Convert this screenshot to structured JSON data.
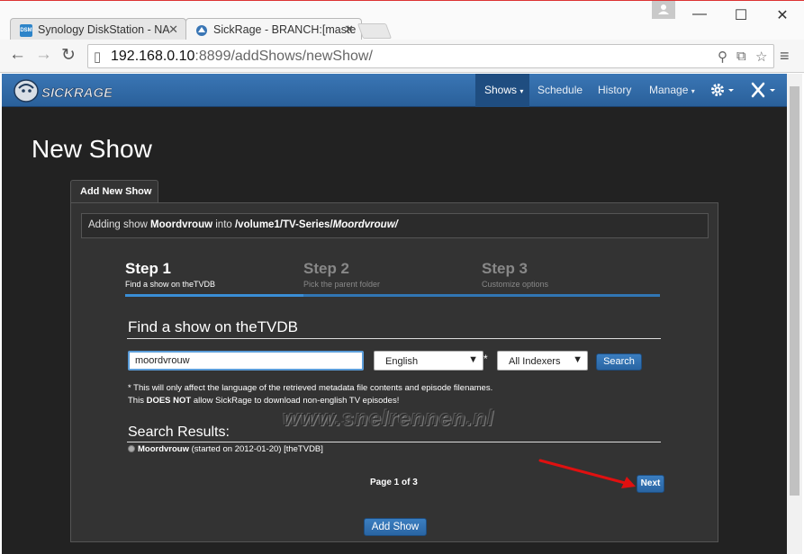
{
  "browser": {
    "tabs": [
      {
        "title": "Synology DiskStation - NA",
        "favicon_label": "DSM",
        "active": false
      },
      {
        "title": "SickRage - BRANCH:[maste",
        "active": true
      }
    ],
    "url": {
      "host": "192.168.0.10",
      "rest": ":8899/addShows/newShow/"
    }
  },
  "navbar": {
    "logo": "SICKRAGE",
    "items": [
      {
        "label": "Shows",
        "caret": "▾",
        "active": true
      },
      {
        "label": "Schedule"
      },
      {
        "label": "History"
      },
      {
        "label": "Manage",
        "caret": "▾"
      }
    ]
  },
  "page": {
    "title": "New Show",
    "tab": "Add New Show",
    "adding": {
      "prefix": "Adding show ",
      "show": "Moordvrouw",
      "middle": " into ",
      "path": "/volume1/TV-Series/",
      "folder": "Moordvrouw/"
    },
    "steps": [
      {
        "title": "Step 1",
        "desc": "Find a show on theTVDB",
        "state": "done"
      },
      {
        "title": "Step 2",
        "desc": "Pick the parent folder",
        "state": "todo"
      },
      {
        "title": "Step 3",
        "desc": "Customize options",
        "state": "todo"
      }
    ],
    "find_title": "Find a show on theTVDB",
    "search_value": "moordvrouw",
    "language": "English",
    "asterisk": "*",
    "indexer": "All Indexers",
    "search_button": "Search",
    "note": {
      "line1": "* This will only affect the language of the retrieved metadata file contents and episode filenames.",
      "line2_pre": "This ",
      "line2_bold": "DOES NOT",
      "line2_post": " allow SickRage to download non-english TV episodes!"
    },
    "watermark": "www.snelrennen.nl",
    "results_title": "Search Results:",
    "result": {
      "show": "Moordvrouw",
      "details": " (started on 2012-01-20) [theTVDB]"
    },
    "pager": "Page 1 of 3",
    "next_button": "Next",
    "add_button": "Add Show"
  },
  "colors": {
    "navbar": "#2a609a",
    "page_bg": "#222222",
    "panel_bg": "#333333",
    "accent": "#3a8ed6",
    "arrow": "#e01010"
  }
}
